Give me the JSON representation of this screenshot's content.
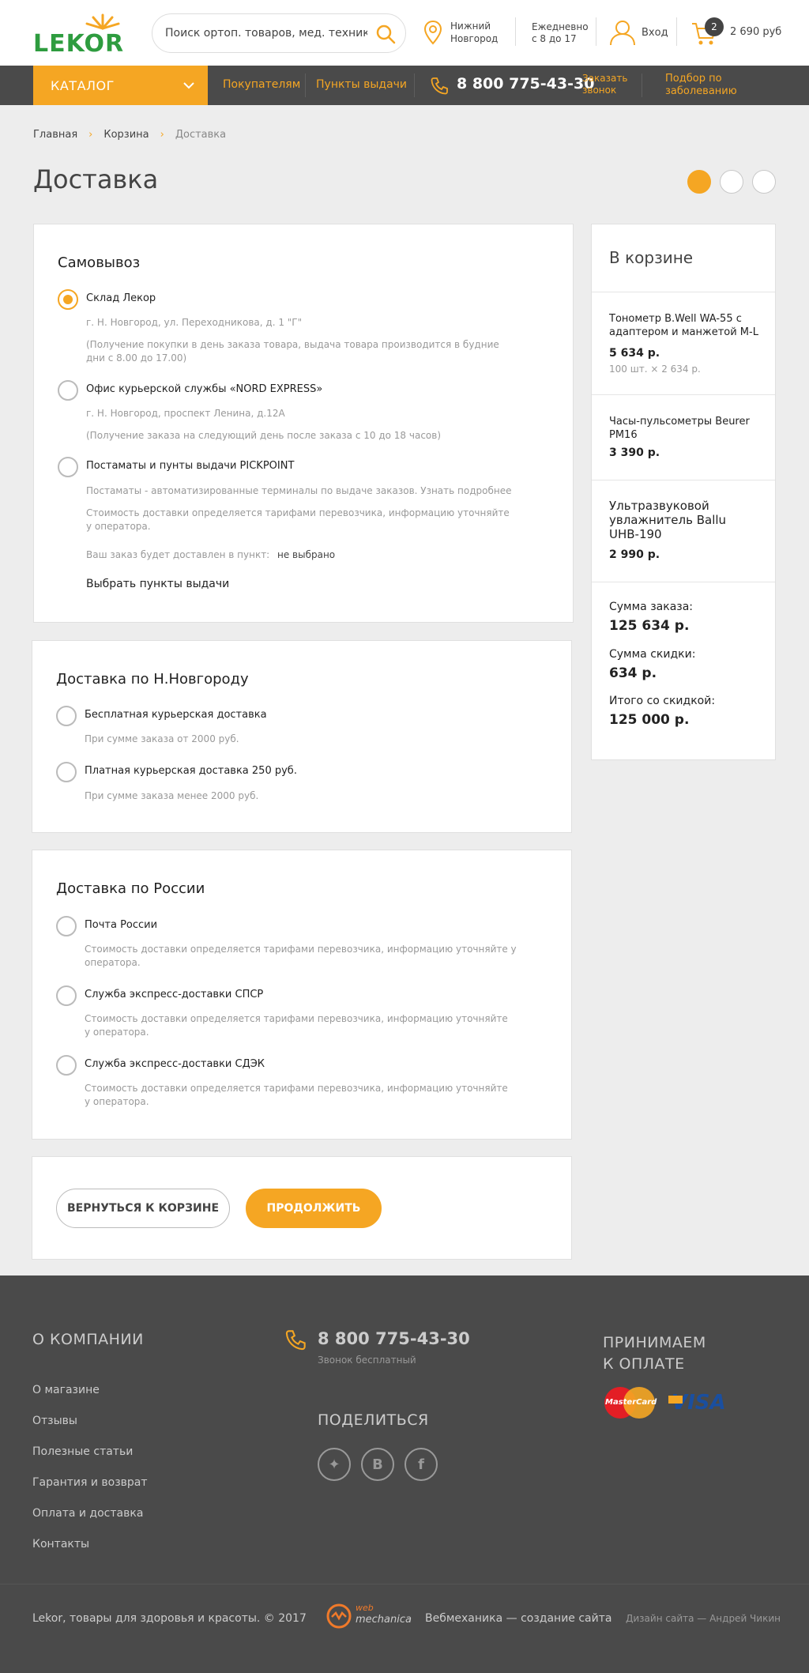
{
  "header": {
    "logo_text": "LEKOR",
    "search_placeholder": "Поиск ортоп. товаров, мед. техники",
    "city_line1": "Нижний",
    "city_line2": "Новгород",
    "hours_line1": "Ежедневно",
    "hours_line2": "с 8 до 17",
    "login": "Вход",
    "cart_count": "2",
    "cart_sum": "2 690 руб"
  },
  "nav": {
    "catalog": "КАТАЛОГ",
    "buyers": "Покупателям",
    "pickup_points": "Пункты выдачи",
    "phone": "8 800 775-43-30",
    "call_line1": "Заказать",
    "call_line2": "звонок",
    "pick_line1": "Подбор по",
    "pick_line2": "заболеванию"
  },
  "breadcrumbs": {
    "home": "Главная",
    "cart": "Корзина",
    "current": "Доставка",
    "separator": "›"
  },
  "page_title": "Доставка",
  "pickup": {
    "title": "Самовывоз",
    "options": [
      {
        "label": "Склад Лекор",
        "address": "г. Н. Новгород, ул. Переходникова, д. 1 \"Г\"",
        "note_line1": "(Получение покупки в день заказа товара, выдача товара производится в будние",
        "note_line2": "дни с 8.00 до 17.00)"
      },
      {
        "label": "Офис курьерской службы «NORD EXPRESS»",
        "address": "г. Н. Новгород, проспект Ленина, д.12А",
        "note_line1": "(Получение заказа на следующий день после заказа с 10 до 18 часов)"
      },
      {
        "label": "Постаматы и пунты выдачи PICKPOINT",
        "address": "Постаматы - автоматизированные терминалы по выдаче заказов. Узнать подробнее",
        "note_line1": "Стоимость доставки определяется тарифами перевозчика, информацию уточняйте",
        "note_line2": "у оператора."
      }
    ],
    "delivered_label": "Ваш заказ будет доставлен в пункт:",
    "delivered_value": "не выбрано",
    "choose_link": "Выбрать пункты выдачи"
  },
  "city_delivery": {
    "title": "Доставка по Н.Новгороду",
    "options": [
      {
        "label": "Бесплатная курьерская доставка",
        "note": "При сумме заказа от 2000 руб."
      },
      {
        "label": "Платная курьерская доставка 250 руб.",
        "note": "При сумме заказа менее 2000 руб."
      }
    ]
  },
  "russia_delivery": {
    "title": "Доставка по России",
    "options": [
      {
        "label": "Почта России",
        "note_line1": "Стоимость доставки определяется тарифами перевозчика, информацию уточняйте у",
        "note_line2": "оператора."
      },
      {
        "label": "Служба экспресс-доставки СПСР",
        "note_line1": "Стоимость доставки определяется тарифами перевозчика, информацию уточняйте",
        "note_line2": "у оператора."
      },
      {
        "label": "Служба экспресс-доставки СДЭК",
        "note_line1": "Стоимость доставки определяется тарифами перевозчика, информацию уточняйте",
        "note_line2": "у оператора."
      }
    ]
  },
  "buttons": {
    "back": "ВЕРНУТЬСЯ К КОРЗИНЕ",
    "continue": "ПРОДОЛЖИТЬ"
  },
  "sidebar": {
    "title": "В корзине",
    "items": [
      {
        "name_line1": "Тонометр B.Well WA-55 с",
        "name_line2": "адаптером и манжетой M-L",
        "price": "5 634 р.",
        "qty": "100 шт. × 2 634 р."
      },
      {
        "name_line1": "Часы-пульсометры Beurer",
        "name_line2": "PM16",
        "price": "3 390 р."
      },
      {
        "name_line1": "Ультразвуковой",
        "name_line2": "увлажнитель Ballu",
        "name_line3": "UHB-190",
        "price": "2 990 р."
      }
    ],
    "order_sum_label": "Сумма заказа:",
    "order_sum": "125 634 р.",
    "discount_label": "Сумма скидки:",
    "discount": "634 р.",
    "total_label": "Итого со скидкой:",
    "total": "125 000 р."
  },
  "footer": {
    "company_title": "О КОМПАНИИ",
    "links": [
      "О  магазине",
      "Отзывы",
      "Полезные статьи",
      "Гарантия и возврат",
      "Оплата и доставка",
      "Контакты"
    ],
    "phone": "8 800 775-43-30",
    "phone_note": "Звонок бесплатный",
    "share_title": "ПОДЕЛИТЬСЯ",
    "payment_line1": "ПРИНИМАЕМ",
    "payment_line2": "К ОПЛАТЕ",
    "mastercard": "MasterCard",
    "visa": "VISA",
    "copyright": "Lekor, товары для здоровья и красоты. © 2017",
    "wm_logo_line1": "web",
    "wm_logo_line2": "mechanica",
    "wm_text": "Вебмеханика — создание сайта",
    "design": "Дизайн сайта — Андрей Чикин"
  },
  "colors": {
    "accent": "#f5a623",
    "brand_green": "#2e9c3f",
    "dark": "#4a4a4a"
  }
}
